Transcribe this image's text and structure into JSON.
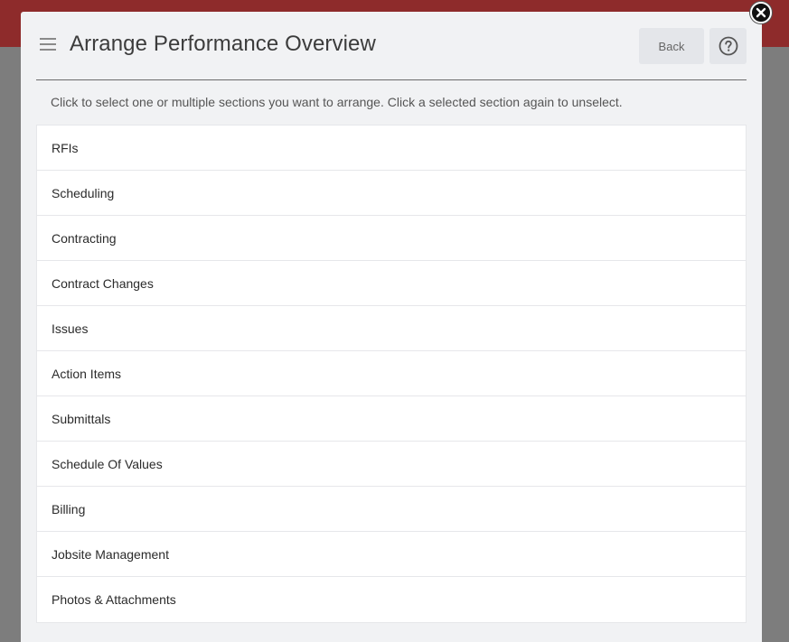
{
  "modal": {
    "title": "Arrange Performance Overview",
    "back_label": "Back",
    "instructions": "Click to select one or multiple sections you want to arrange. Click a selected section again to unselect."
  },
  "sections": [
    {
      "label": "RFIs"
    },
    {
      "label": "Scheduling"
    },
    {
      "label": "Contracting"
    },
    {
      "label": "Contract Changes"
    },
    {
      "label": "Issues"
    },
    {
      "label": "Action Items"
    },
    {
      "label": "Submittals"
    },
    {
      "label": "Schedule Of Values"
    },
    {
      "label": "Billing"
    },
    {
      "label": "Jobsite Management"
    },
    {
      "label": "Photos & Attachments"
    }
  ],
  "icons": {
    "menu": "menu-icon",
    "help": "help-circle-icon",
    "close": "close-icon"
  },
  "colors": {
    "header_bar": "#8e2b2b",
    "overlay": "#7d7d7d",
    "modal_bg": "#f1f2f4"
  }
}
